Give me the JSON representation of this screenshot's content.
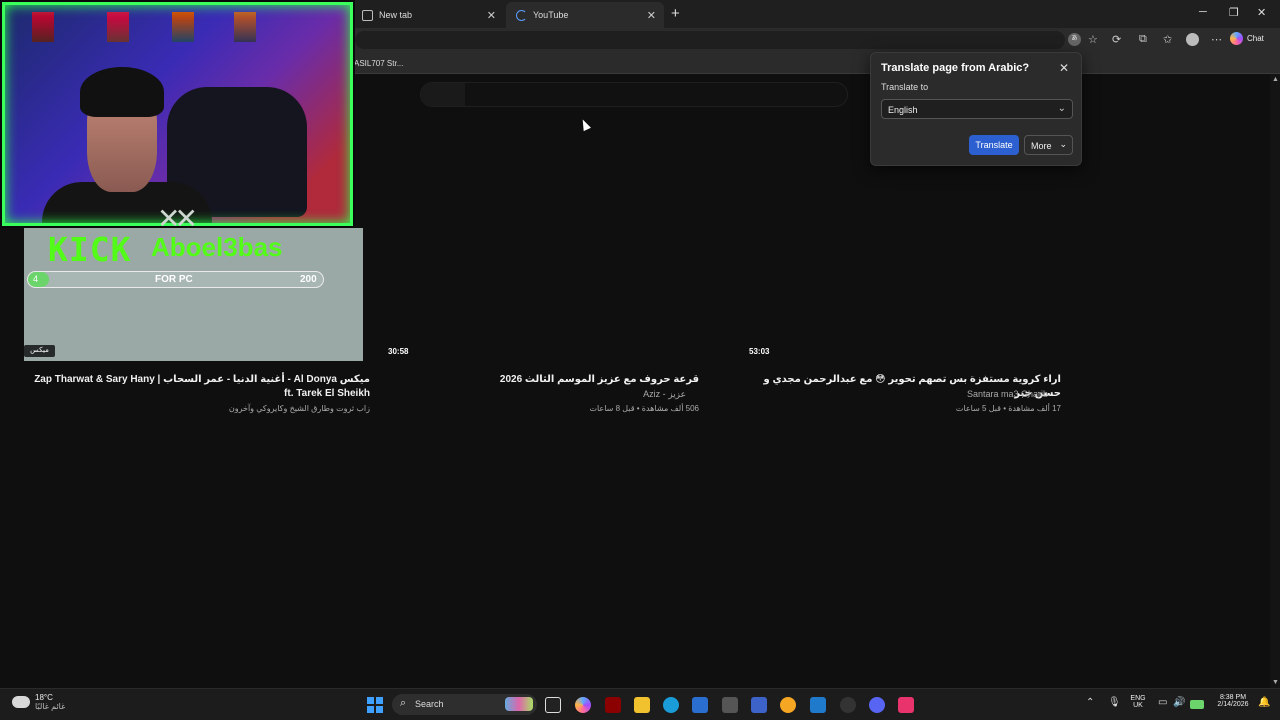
{
  "browser": {
    "tabs": [
      {
        "title": "New tab",
        "active": false
      },
      {
        "title": "YouTube",
        "active": true
      }
    ],
    "bookmark": "ASIL707 Str...",
    "chat_label": "Chat"
  },
  "videos": [
    {
      "duration": "",
      "title": "ميكس Al Donya - أغنية الدنيا - عمر السحاب | Zap Tharwat & Sary Hany ft. Tarek El Sheikh",
      "channel": "",
      "meta": "زاب ثروت وطارق الشيخ وكايروكي وآخرون"
    },
    {
      "duration": "30:58",
      "title": "قرعة حروف مع عزيز الموسم الثالث 2026",
      "channel": "Aziz - عزيز",
      "meta": "506 ألف مشاهدة • قبل 8 ساعات"
    },
    {
      "duration": "53:03",
      "title": "اراء كروية مستفزة بس تصهم تحوير 😳 مع عبدالرحمن مجدي و حسن جبر",
      "channel": "Santara ma3 Gharib",
      "meta": "17 ألف مشاهدة • قبل 5 ساعات"
    }
  ],
  "overlay": {
    "kick_logo": "KICK",
    "streamer": "Aboel3bas",
    "goal_start": "4",
    "goal_label": "FOR PC",
    "goal_end": "200",
    "goal_progress": 0.02,
    "badge": "ميكس"
  },
  "translate": {
    "title": "Translate page from Arabic?",
    "label": "Translate to",
    "language": "English",
    "translate_btn": "Translate",
    "more_btn": "More"
  },
  "taskbar": {
    "temp": "18°C",
    "condition": "غائم غالبًا",
    "search": "Search",
    "lang": "ENG",
    "region": "UK",
    "time": "8:38 PM",
    "date": "2/14/2026"
  }
}
